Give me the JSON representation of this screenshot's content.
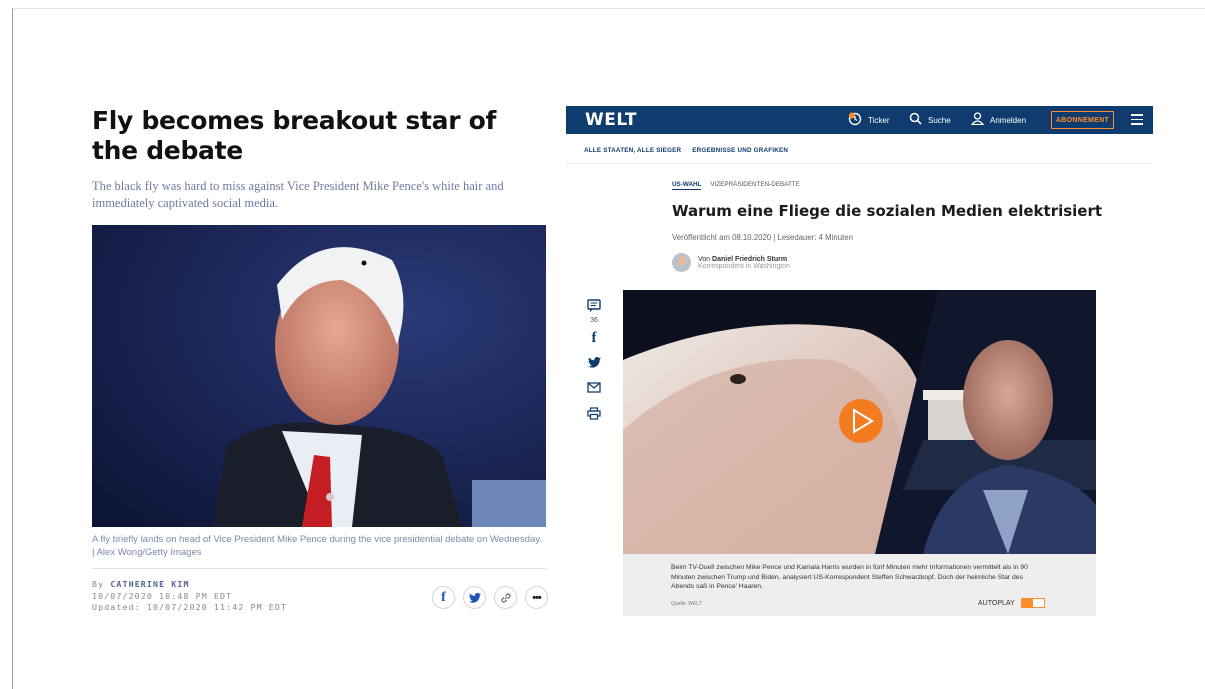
{
  "left_article": {
    "headline": "Fly becomes breakout star of the debate",
    "subheadline": "The black fly was hard to miss against Vice President Mike Pence's white hair and immediately captivated social media.",
    "caption": "A fly briefly lands on head of Vice President Mike Pence during the vice presidential debate on Wednesday. | Alex Wong/Getty Images",
    "by_prefix": "By",
    "author": "CATHERINE KIM",
    "published": "10/07/2020 10:48 PM EDT",
    "updated": "Updated: 10/07/2020 11:42 PM EDT",
    "share_icons": [
      "facebook-icon",
      "twitter-icon",
      "link-icon",
      "more-icon"
    ]
  },
  "welt": {
    "logo": "WELT",
    "nav": {
      "ticker": "Ticker",
      "search": "Suche",
      "login": "Anmelden",
      "subscribe": "ABONNEMENT"
    },
    "subnav": [
      "ALLE STAATEN, ALLE SIEGER",
      "ERGEBNISSE UND GRAFIKEN"
    ],
    "kicker_primary": "US-WAHL",
    "kicker_secondary": "VIZEPRÄSIDENTEN-DEBATTE",
    "title": "Warum eine Fliege die sozialen Medien elektrisiert",
    "meta": "Veröffentlicht am 08.10.2020 | Lesedauer: 4 Minuten",
    "author_prefix": "Von",
    "author": "Daniel Friedrich Sturm",
    "author_role": "Korrespondent in Washington",
    "comment_count": "36",
    "video_caption": "Beim TV-Duell zwischen Mike Pence und Kamala Harris wurden in fünf Minuten mehr Informationen vermittelt als in 90 Minuten zwischen Trump und Biden, analysiert US-Korrespondent Steffen Schwarzkopf. Doch der heimliche Star des Abends saß in Pence' Haaren.",
    "video_source": "Quelle: WELT",
    "autoplay": "AUTOPLAY",
    "colors": {
      "brand_blue": "#0f3b6e",
      "accent_orange": "#ff8c2a"
    }
  }
}
